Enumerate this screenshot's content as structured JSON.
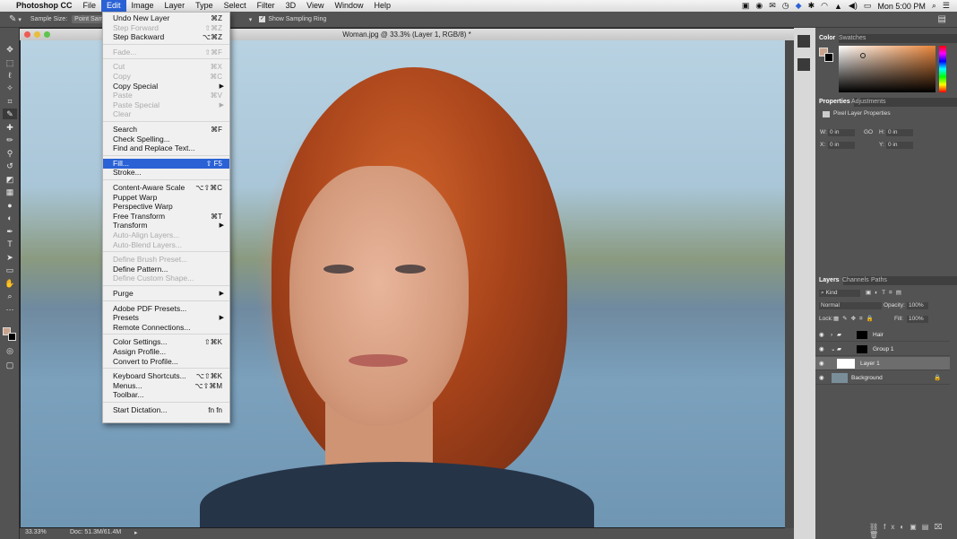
{
  "menubar": {
    "apple": "",
    "app": "Photoshop CC",
    "items": [
      "File",
      "Edit",
      "Image",
      "Layer",
      "Type",
      "Select",
      "Filter",
      "3D",
      "View",
      "Window",
      "Help"
    ],
    "active": "Edit",
    "clock": "Mon 5:00 PM"
  },
  "options": {
    "sample_size_label": "Sample Size:",
    "sample_size_value": "Point Sample",
    "show_ring": "Show Sampling Ring"
  },
  "document": {
    "title": "Woman.jpg @ 33.3% (Layer 1, RGB/8) *",
    "zoom": "33.33%",
    "doc_size": "Doc: 51.3M/61.4M"
  },
  "edit_menu": [
    {
      "label": "Undo New Layer",
      "shortcut": "⌘Z",
      "disabled": false
    },
    {
      "label": "Step Forward",
      "shortcut": "⇧⌘Z",
      "disabled": true
    },
    {
      "label": "Step Backward",
      "shortcut": "⌥⌘Z",
      "disabled": false
    },
    {
      "sep": true
    },
    {
      "label": "Fade...",
      "shortcut": "⇧⌘F",
      "disabled": true
    },
    {
      "sep": true
    },
    {
      "label": "Cut",
      "shortcut": "⌘X",
      "disabled": true
    },
    {
      "label": "Copy",
      "shortcut": "⌘C",
      "disabled": true
    },
    {
      "label": "Copy Special",
      "shortcut": "",
      "submenu": true,
      "disabled": false
    },
    {
      "label": "Paste",
      "shortcut": "⌘V",
      "disabled": true
    },
    {
      "label": "Paste Special",
      "shortcut": "",
      "submenu": true,
      "disabled": true
    },
    {
      "label": "Clear",
      "shortcut": "",
      "disabled": true
    },
    {
      "sep": true
    },
    {
      "label": "Search",
      "shortcut": "⌘F",
      "disabled": false
    },
    {
      "label": "Check Spelling...",
      "shortcut": "",
      "disabled": false
    },
    {
      "label": "Find and Replace Text...",
      "shortcut": "",
      "disabled": false
    },
    {
      "sep": true
    },
    {
      "label": "Fill...",
      "shortcut": "⇧ F5",
      "disabled": false,
      "highlight": true
    },
    {
      "label": "Stroke...",
      "shortcut": "",
      "disabled": false
    },
    {
      "sep": true
    },
    {
      "label": "Content-Aware Scale",
      "shortcut": "⌥⇧⌘C",
      "disabled": false
    },
    {
      "label": "Puppet Warp",
      "shortcut": "",
      "disabled": false
    },
    {
      "label": "Perspective Warp",
      "shortcut": "",
      "disabled": false
    },
    {
      "label": "Free Transform",
      "shortcut": "⌘T",
      "disabled": false
    },
    {
      "label": "Transform",
      "shortcut": "",
      "submenu": true,
      "disabled": false
    },
    {
      "label": "Auto-Align Layers...",
      "shortcut": "",
      "disabled": true
    },
    {
      "label": "Auto-Blend Layers...",
      "shortcut": "",
      "disabled": true
    },
    {
      "sep": true
    },
    {
      "label": "Define Brush Preset...",
      "shortcut": "",
      "disabled": true
    },
    {
      "label": "Define Pattern...",
      "shortcut": "",
      "disabled": false
    },
    {
      "label": "Define Custom Shape...",
      "shortcut": "",
      "disabled": true
    },
    {
      "sep": true
    },
    {
      "label": "Purge",
      "shortcut": "",
      "submenu": true,
      "disabled": false
    },
    {
      "sep": true
    },
    {
      "label": "Adobe PDF Presets...",
      "shortcut": "",
      "disabled": false
    },
    {
      "label": "Presets",
      "shortcut": "",
      "submenu": true,
      "disabled": false
    },
    {
      "label": "Remote Connections...",
      "shortcut": "",
      "disabled": false
    },
    {
      "sep": true
    },
    {
      "label": "Color Settings...",
      "shortcut": "⇧⌘K",
      "disabled": false
    },
    {
      "label": "Assign Profile...",
      "shortcut": "",
      "disabled": false
    },
    {
      "label": "Convert to Profile...",
      "shortcut": "",
      "disabled": false
    },
    {
      "sep": true
    },
    {
      "label": "Keyboard Shortcuts...",
      "shortcut": "⌥⇧⌘K",
      "disabled": false
    },
    {
      "label": "Menus...",
      "shortcut": "⌥⇧⌘M",
      "disabled": false
    },
    {
      "label": "Toolbar...",
      "shortcut": "",
      "disabled": false
    },
    {
      "sep": true
    },
    {
      "label": "Start Dictation...",
      "shortcut": "fn fn",
      "disabled": false
    }
  ],
  "color_panel": {
    "tabs": [
      "Color",
      "Swatches"
    ]
  },
  "properties_panel": {
    "tabs": [
      "Properties",
      "Adjustments"
    ],
    "heading": "Pixel Layer Properties",
    "w_label": "W:",
    "w_value": "0 in",
    "h_label": "H:",
    "h_value": "0 in",
    "x_label": "X:",
    "x_value": "0 in",
    "y_label": "Y:",
    "y_value": "0 in",
    "link_label": "GO"
  },
  "layers_panel": {
    "tabs": [
      "Layers",
      "Channels",
      "Paths"
    ],
    "kind": "Kind",
    "blend_mode": "Normal",
    "opacity_label": "Opacity:",
    "opacity_value": "100%",
    "lock_label": "Lock:",
    "fill_label": "Fill:",
    "fill_value": "100%",
    "layers": [
      {
        "name": "Hair"
      },
      {
        "name": "Group 1"
      },
      {
        "name": "Layer 1"
      },
      {
        "name": "Background"
      }
    ]
  },
  "colors": {
    "accent": "#2a62d6",
    "panel": "#535353",
    "menu_bg": "#f0f0f0"
  }
}
